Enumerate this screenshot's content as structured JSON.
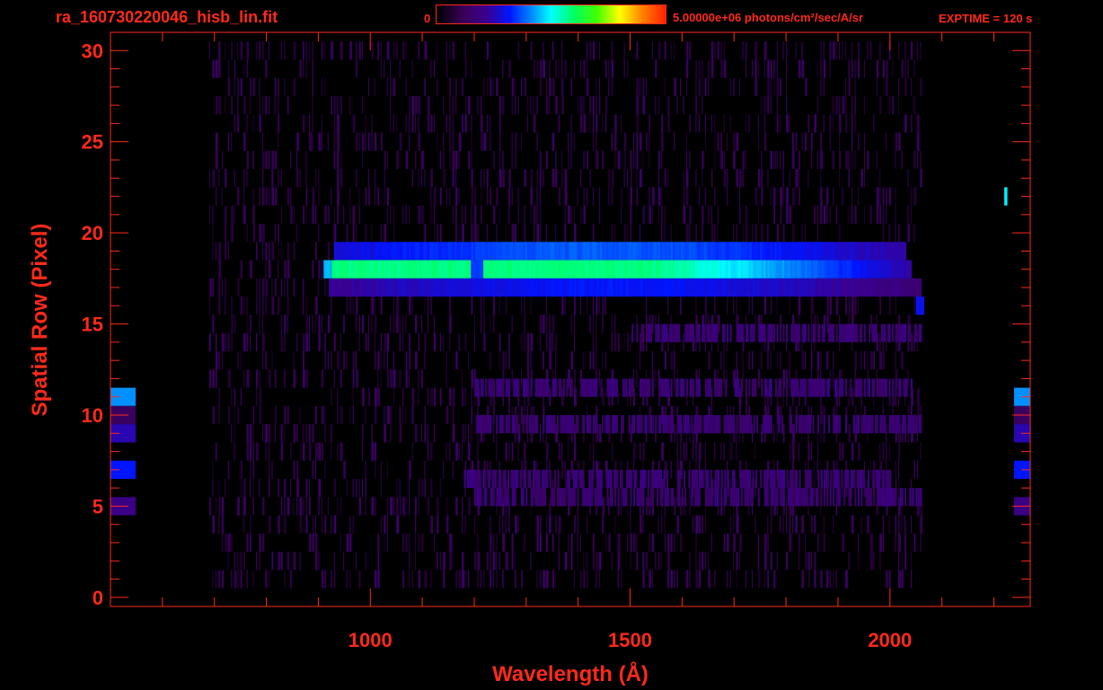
{
  "header": {
    "file_title": "ra_160730220046_hisb_lin.fit",
    "colorbar_min": "0",
    "colorbar_max": "5.00000e+06 photons/cm²/sec/A/sr",
    "exptime": "EXPTIME = 120 s"
  },
  "colors": {
    "axis": "#ff2a1a",
    "background": "#000000"
  },
  "chart_data": {
    "type": "heatmap",
    "title": "ra_160730220046_hisb_lin.fit",
    "xlabel": "Wavelength (Å)",
    "ylabel": "Spatial Row (Pixel)",
    "xlim": [
      500,
      2270
    ],
    "ylim": [
      -0.5,
      31
    ],
    "x_ticks": [
      1000,
      1500,
      2000
    ],
    "y_ticks": [
      0,
      5,
      10,
      15,
      20,
      25,
      30
    ],
    "colorbar": {
      "min": 0,
      "max": 5000000,
      "units": "photons/cm²/sec/A/sr",
      "scale": "linear"
    },
    "exptime_s": 120,
    "bands": [
      {
        "row": 19,
        "x_start": 930,
        "x_end": 2030,
        "level": 0.28
      },
      {
        "row": 18,
        "x_start": 910,
        "x_end": 2040,
        "level": 0.6
      },
      {
        "row": 17,
        "x_start": 920,
        "x_end": 2060,
        "level": 0.22
      },
      {
        "row": 16,
        "x_start": 2050,
        "x_end": 2065,
        "level": 0.3
      },
      {
        "row": 22,
        "x_start": 2220,
        "x_end": 2225,
        "level": 0.5
      }
    ]
  }
}
